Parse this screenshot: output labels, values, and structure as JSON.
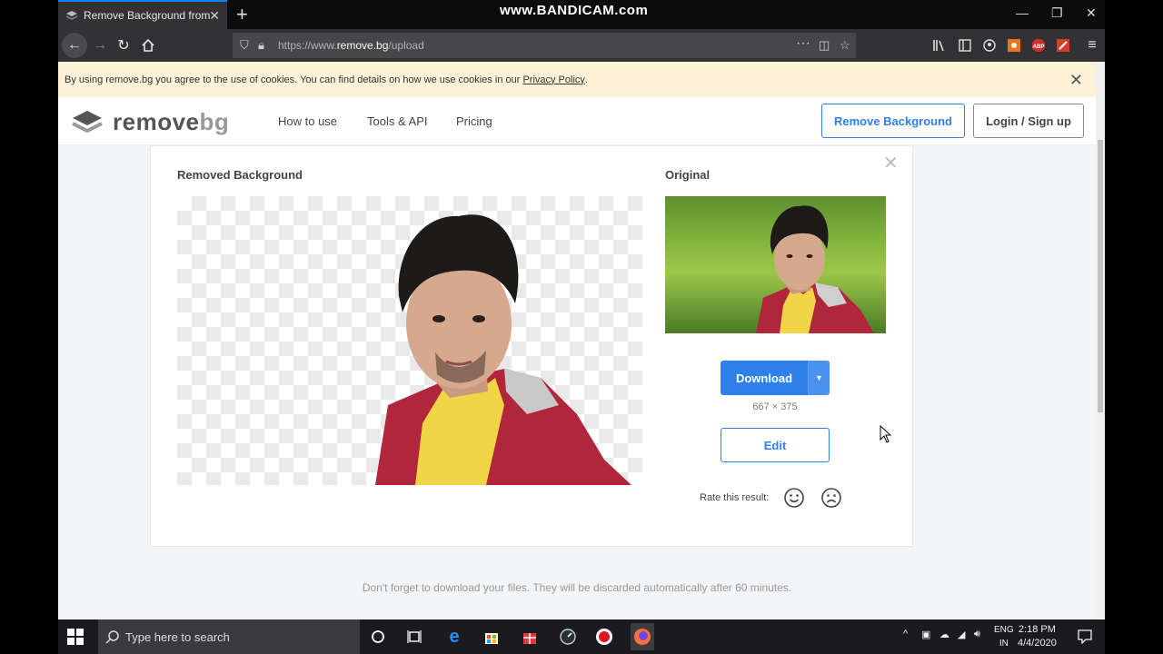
{
  "recorder_watermark": "www.BANDICAM.com",
  "browser": {
    "tab_title": "Remove Background from Ima",
    "url_prefix": "https://www.",
    "url_host": "remove.bg",
    "url_path": "/upload"
  },
  "cookie_bar": {
    "text": "By using remove.bg you agree to the use of cookies. You can find details on how we use cookies in our",
    "link": "Privacy Policy",
    "suffix": "."
  },
  "header": {
    "logo_main": "remove",
    "logo_sub": "bg",
    "nav": [
      "How to use",
      "Tools & API",
      "Pricing"
    ],
    "remove_background_btn": "Remove Background",
    "login_btn": "Login / Sign up"
  },
  "card": {
    "removed_title": "Removed Background",
    "original_title": "Original",
    "download_label": "Download",
    "dimensions": "667 × 375",
    "edit_label": "Edit",
    "rate_label": "Rate this result:"
  },
  "footnote": "Don't forget to download your files. They will be discarded automatically after 60 minutes.",
  "taskbar": {
    "search_placeholder": "Type here to search",
    "lang_top": "ENG",
    "lang_bottom": "IN",
    "time": "2:18 PM",
    "date": "4/4/2020"
  },
  "colors": {
    "accent": "#2f80ed",
    "cookie_bg": "#fdf1d7"
  }
}
